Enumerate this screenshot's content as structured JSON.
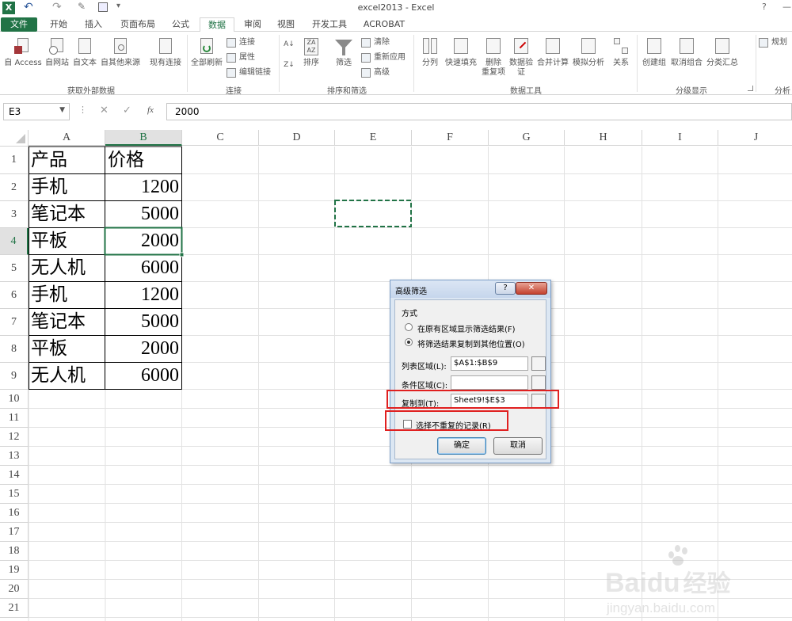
{
  "titlebar": {
    "title": "excel2013 - Excel",
    "help": "?",
    "minimize": "—"
  },
  "tabs": [
    "文件",
    "开始",
    "插入",
    "页面布局",
    "公式",
    "数据",
    "审阅",
    "视图",
    "开发工具",
    "ACROBAT"
  ],
  "active_tab": "数据",
  "ribbon": {
    "groups": {
      "external": "获取外部数据",
      "connections": "连接",
      "sortfilter": "排序和筛选",
      "datatools": "数据工具",
      "outline": "分级显示",
      "analysis": "分析"
    },
    "buttons": {
      "access": "自 Access",
      "web": "自网站",
      "text": "自文本",
      "other": "自其他来源",
      "existing": "现有连接",
      "refresh": "全部刷新",
      "connections": "连接",
      "properties": "属性",
      "editlinks": "编辑链接",
      "sort": "排序",
      "filter": "筛选",
      "clear": "清除",
      "reapply": "重新应用",
      "advanced": "高级",
      "split": "分列",
      "flashfill": "快速填充",
      "removedup_1": "删除",
      "removedup_2": "重复项",
      "validation_1": "数据验",
      "validation_2": "证",
      "consolidate": "合并计算",
      "whatif": "模拟分析",
      "relations": "关系",
      "group": "创建组",
      "ungroup": "取消组合",
      "subtotal": "分类汇总",
      "solver": "规划求"
    }
  },
  "formula_bar": {
    "namebox": "E3",
    "fx": "fx",
    "value": "2000"
  },
  "columns": [
    "A",
    "B",
    "C",
    "D",
    "E",
    "F",
    "G",
    "H",
    "I",
    "J"
  ],
  "rows": [
    "1",
    "2",
    "3",
    "4",
    "5",
    "6",
    "7",
    "8",
    "9",
    "10",
    "11",
    "12",
    "13",
    "14",
    "15",
    "16",
    "17",
    "18",
    "19",
    "20",
    "21"
  ],
  "table": [
    [
      "产品",
      "价格"
    ],
    [
      "手机",
      "1200"
    ],
    [
      "笔记本",
      "5000"
    ],
    [
      "平板",
      "2000"
    ],
    [
      "无人机",
      "6000"
    ],
    [
      "手机",
      "1200"
    ],
    [
      "笔记本",
      "5000"
    ],
    [
      "平板",
      "2000"
    ],
    [
      "无人机",
      "6000"
    ]
  ],
  "dialog": {
    "title": "高级筛选",
    "help": "?",
    "close": "✕",
    "section": "方式",
    "option1": "在原有区域显示筛选结果(F)",
    "option2": "将筛选结果复制到其他位置(O)",
    "list_label": "列表区域(L):",
    "list_value": "$A$1:$B$9",
    "criteria_label": "条件区域(C):",
    "criteria_value": "",
    "copyto_label": "复制到(T):",
    "copyto_value": "Sheet9!$E$3",
    "unique_label": "选择不重复的记录(R)",
    "ok": "确定",
    "cancel": "取消"
  },
  "watermark": {
    "brand": "Bai",
    "brand2": "du",
    "cn": "经验",
    "url": "jingyan.baidu.com"
  },
  "colors": {
    "excel_green": "#217346",
    "highlight_red": "#e02020",
    "selection": "#217346"
  }
}
